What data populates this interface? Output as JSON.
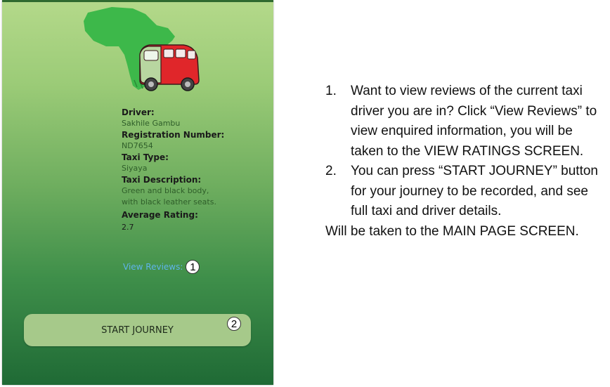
{
  "phone": {
    "details": [
      {
        "label": "Driver:",
        "value": "Sakhile Gambu"
      },
      {
        "label": "Registration Number:",
        "value": "ND7654"
      },
      {
        "label": "Taxi Type:",
        "value": "Siyaya"
      },
      {
        "label": "Taxi Description:",
        "value": "Green and black body, with black leather seats."
      },
      {
        "label": "Average Rating:",
        "value": "2.7"
      }
    ],
    "view_reviews_link": "View Reviews:",
    "start_button": "START JOURNEY",
    "markers": [
      "1",
      "2"
    ]
  },
  "instructions": {
    "items": [
      {
        "num": "1.",
        "text": "Want to view reviews of the current taxi driver you are in? Click “View Reviews” to view enquired information, you will be taken to the VIEW RATINGS SCREEN."
      },
      {
        "num": "2.",
        "text": "You can press “START JOURNEY” button for your journey to be recorded, and see full taxi and driver details."
      }
    ],
    "footer": "Will be taken to the MAIN PAGE SCREEN."
  },
  "colors": {
    "phone_bg_top": "#b4d98a",
    "phone_bg_bottom": "#1f6a35",
    "link": "#5fb4ea",
    "button_bg": "#a6c98a",
    "africa": "#3db84a",
    "taxi_red": "#e0262a"
  }
}
